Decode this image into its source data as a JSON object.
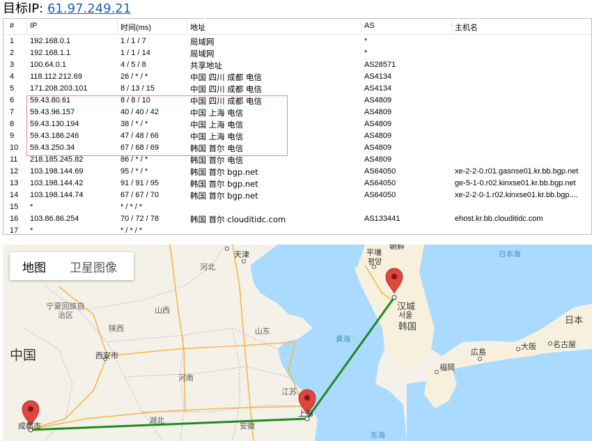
{
  "header": {
    "label": "目标IP:",
    "ip": "61.97.249.21"
  },
  "table": {
    "columns": [
      "#",
      "IP",
      "时间(ms)",
      "地址",
      "AS",
      "主机名"
    ],
    "rows": [
      {
        "n": "1",
        "ip": "192.168.0.1",
        "time": "1 / 1 / 7",
        "loc": "局域网",
        "as": "*",
        "host": ""
      },
      {
        "n": "2",
        "ip": "192.168.1.1",
        "time": "1 / 1 / 14",
        "loc": "局域网",
        "as": "*",
        "host": ""
      },
      {
        "n": "3",
        "ip": "100.64.0.1",
        "time": "4 / 5 / 8",
        "loc": "共享地址",
        "as": "AS28571",
        "host": ""
      },
      {
        "n": "4",
        "ip": "118.112.212.69",
        "time": "26 / * / *",
        "loc": "中国 四川 成都 电信",
        "as": "AS4134",
        "host": ""
      },
      {
        "n": "5",
        "ip": "171.208.203.101",
        "time": "8 / 13 / 15",
        "loc": "中国 四川 成都 电信",
        "as": "AS4134",
        "host": ""
      },
      {
        "n": "6",
        "ip": "59.43.80.61",
        "time": "8 / 8 / 10",
        "loc": "中国 四川 成都 电信",
        "as": "AS4809",
        "host": ""
      },
      {
        "n": "7",
        "ip": "59.43.96.157",
        "time": "40 / 40 / 42",
        "loc": "中国 上海 电信",
        "as": "AS4809",
        "host": ""
      },
      {
        "n": "8",
        "ip": "59.43.130.194",
        "time": "38 / * / *",
        "loc": "中国 上海 电信",
        "as": "AS4809",
        "host": ""
      },
      {
        "n": "9",
        "ip": "59.43.186.246",
        "time": "47 / 48 / 66",
        "loc": "中国 上海 电信",
        "as": "AS4809",
        "host": ""
      },
      {
        "n": "10",
        "ip": "59.43.250.34",
        "time": "67 / 68 / 69",
        "loc": "韩国 首尔 电信",
        "as": "AS4809",
        "host": ""
      },
      {
        "n": "11",
        "ip": "218.185.245.82",
        "time": "86 / * / *",
        "loc": "韩国 首尔 电信",
        "as": "AS4809",
        "host": ""
      },
      {
        "n": "12",
        "ip": "103.198.144.69",
        "time": "95 / * / *",
        "loc": "韩国 首尔 bgp.net",
        "as": "AS64050",
        "host": "xe-2-2-0.r01.gasnse01.kr.bb.bgp.net"
      },
      {
        "n": "13",
        "ip": "103.198.144.42",
        "time": "91 / 91 / 95",
        "loc": "韩国 首尔 bgp.net",
        "as": "AS64050",
        "host": "ge-5-1-0.r02.kinxse01.kr.bb.bgp.net"
      },
      {
        "n": "14",
        "ip": "103.198.144.74",
        "time": "67 / 67 / 70",
        "loc": "韩国 首尔 bgp.net",
        "as": "AS64050",
        "host": "xe-2-2-0-1.r02.kinxse01.kr.bb.bgp...."
      },
      {
        "n": "15",
        "ip": "*",
        "time": "* / * / *",
        "loc": "",
        "as": "",
        "host": ""
      },
      {
        "n": "16",
        "ip": "103.86.86.254",
        "time": "70 / 72 / 78",
        "loc": "韩国 首尔 clouditidc.com",
        "as": "AS133441",
        "host": "ehost.kr.bb.clouditidc.com"
      },
      {
        "n": "17",
        "ip": "*",
        "time": "* / * / *",
        "loc": "",
        "as": "",
        "host": ""
      }
    ]
  },
  "map": {
    "tabs": {
      "map": "地图",
      "satellite": "卫星图像"
    },
    "labels": {
      "tianjin": "天津",
      "hebei": "河北",
      "pyongyang_cn": "平壤",
      "pyongyang_kr": "평양",
      "north_korea_partial": "朝鲜",
      "japan_sea": "日本海",
      "ningxia": "宁夏回族自治区",
      "shanxi": "山西",
      "shaanxi": "陕西",
      "shandong": "山东",
      "yellow_sea": "黄海",
      "seoul_cn": "汉城",
      "seoul_kr": "서울",
      "korea": "韩国",
      "china": "中国",
      "xian": "西安市",
      "henan": "河南",
      "jiangsu": "江苏",
      "hubei": "湖北",
      "anhui": "安徽",
      "shanghai": "上海",
      "chengdu": "成都市",
      "east_sea": "东海",
      "japan": "日本",
      "hiroshima": "広島",
      "osaka": "大阪",
      "nagoya": "名古屋",
      "fukuoka": "福岡"
    },
    "colors": {
      "route": "#1e8a1e",
      "marker": "#d93b30",
      "water": "#aadaff",
      "land": "#f4f1e8"
    }
  }
}
